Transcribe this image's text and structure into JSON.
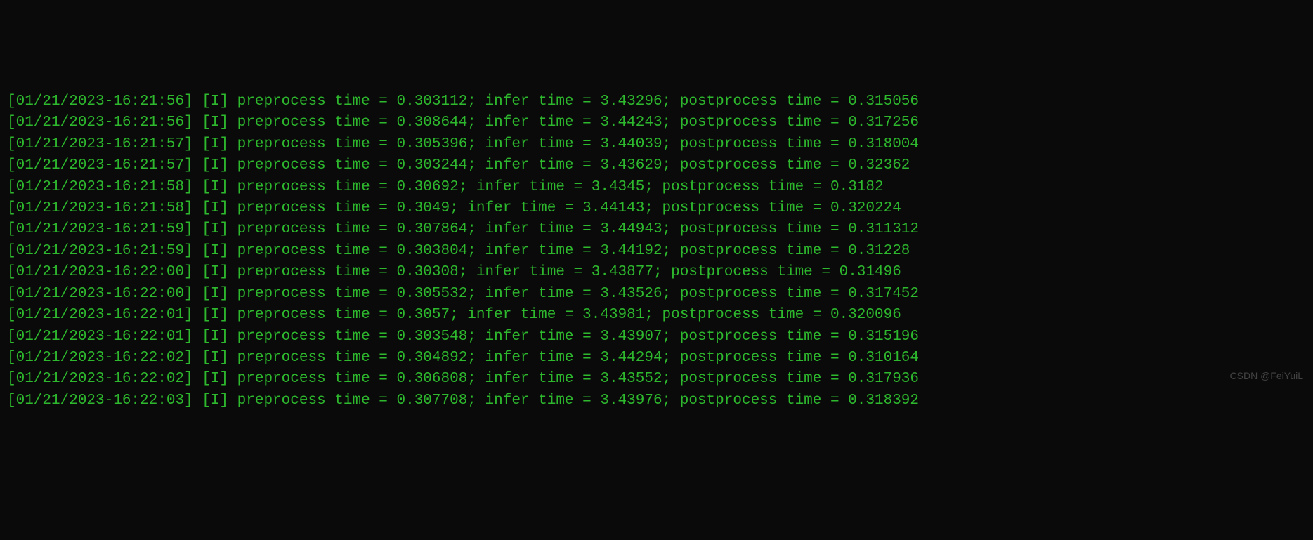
{
  "watermark": "CSDN @FeiYuiL",
  "labels": {
    "level": "[I]",
    "pre": "preprocess time",
    "inf": "infer time",
    "post": "postprocess time"
  },
  "logs": [
    {
      "ts": "01/21/2023-16:21:56",
      "pre": "0.303112",
      "inf": "3.43296",
      "post": "0.315056"
    },
    {
      "ts": "01/21/2023-16:21:56",
      "pre": "0.308644",
      "inf": "3.44243",
      "post": "0.317256"
    },
    {
      "ts": "01/21/2023-16:21:57",
      "pre": "0.305396",
      "inf": "3.44039",
      "post": "0.318004"
    },
    {
      "ts": "01/21/2023-16:21:57",
      "pre": "0.303244",
      "inf": "3.43629",
      "post": "0.32362"
    },
    {
      "ts": "01/21/2023-16:21:58",
      "pre": "0.30692",
      "inf": "3.4345",
      "post": "0.3182"
    },
    {
      "ts": "01/21/2023-16:21:58",
      "pre": "0.3049",
      "inf": "3.44143",
      "post": "0.320224"
    },
    {
      "ts": "01/21/2023-16:21:59",
      "pre": "0.307864",
      "inf": "3.44943",
      "post": "0.311312"
    },
    {
      "ts": "01/21/2023-16:21:59",
      "pre": "0.303804",
      "inf": "3.44192",
      "post": "0.31228"
    },
    {
      "ts": "01/21/2023-16:22:00",
      "pre": "0.30308",
      "inf": "3.43877",
      "post": "0.31496"
    },
    {
      "ts": "01/21/2023-16:22:00",
      "pre": "0.305532",
      "inf": "3.43526",
      "post": "0.317452"
    },
    {
      "ts": "01/21/2023-16:22:01",
      "pre": "0.3057",
      "inf": "3.43981",
      "post": "0.320096"
    },
    {
      "ts": "01/21/2023-16:22:01",
      "pre": "0.303548",
      "inf": "3.43907",
      "post": "0.315196"
    },
    {
      "ts": "01/21/2023-16:22:02",
      "pre": "0.304892",
      "inf": "3.44294",
      "post": "0.310164"
    },
    {
      "ts": "01/21/2023-16:22:02",
      "pre": "0.306808",
      "inf": "3.43552",
      "post": "0.317936"
    },
    {
      "ts": "01/21/2023-16:22:03",
      "pre": "0.307708",
      "inf": "3.43976",
      "post": "0.318392"
    }
  ]
}
